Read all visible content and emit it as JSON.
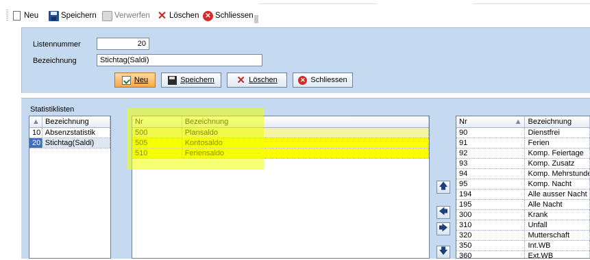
{
  "toolbar": {
    "new": "Neu",
    "save": "Speichern",
    "discard": "Verwerfen",
    "delete": "Löschen",
    "close": "Schliessen"
  },
  "form": {
    "list_number_label": "Listennummer",
    "list_number_value": "20",
    "description_label": "Bezeichnung",
    "description_value": "Stichtag(Saldi)",
    "buttons": {
      "new": "Neu",
      "save": "Speichern",
      "delete": "Löschen",
      "close": "Schliessen"
    }
  },
  "stat_lists": {
    "title": "Statistiklisten",
    "header_name": "Bezeichnung",
    "rows": [
      {
        "nr": "10",
        "name": "Absenzstatistik"
      },
      {
        "nr": "20",
        "name": "Stichtag(Saldi)"
      }
    ]
  },
  "middle_grid": {
    "header_nr": "Nr",
    "header_name": "Bezeichnung",
    "rows": [
      {
        "nr": "500",
        "name": "Plansaldo"
      },
      {
        "nr": "505",
        "name": "Kontosaldo"
      },
      {
        "nr": "510",
        "name": "Feriensaldo"
      }
    ]
  },
  "right_grid": {
    "header_nr": "Nr",
    "header_name": "Bezeichnung",
    "rows": [
      {
        "nr": "90",
        "name": "Dienstfrei"
      },
      {
        "nr": "91",
        "name": "Ferien"
      },
      {
        "nr": "92",
        "name": "Komp. Feiertage"
      },
      {
        "nr": "93",
        "name": "Komp. Zusatz"
      },
      {
        "nr": "94",
        "name": "Komp. Mehrstunden"
      },
      {
        "nr": "95",
        "name": "Komp. Nacht"
      },
      {
        "nr": "194",
        "name": "Alle ausser Nacht"
      },
      {
        "nr": "195",
        "name": "Alle Nacht"
      },
      {
        "nr": "300",
        "name": "Krank"
      },
      {
        "nr": "310",
        "name": "Unfall"
      },
      {
        "nr": "320",
        "name": "Mutterschaft"
      },
      {
        "nr": "350",
        "name": "Int.WB"
      },
      {
        "nr": "360",
        "name": "Ext.WB"
      }
    ]
  },
  "side_buttons": [
    "up-arrow-icon",
    "move-left-icon",
    "move-right-icon",
    "down-arrow-icon"
  ]
}
